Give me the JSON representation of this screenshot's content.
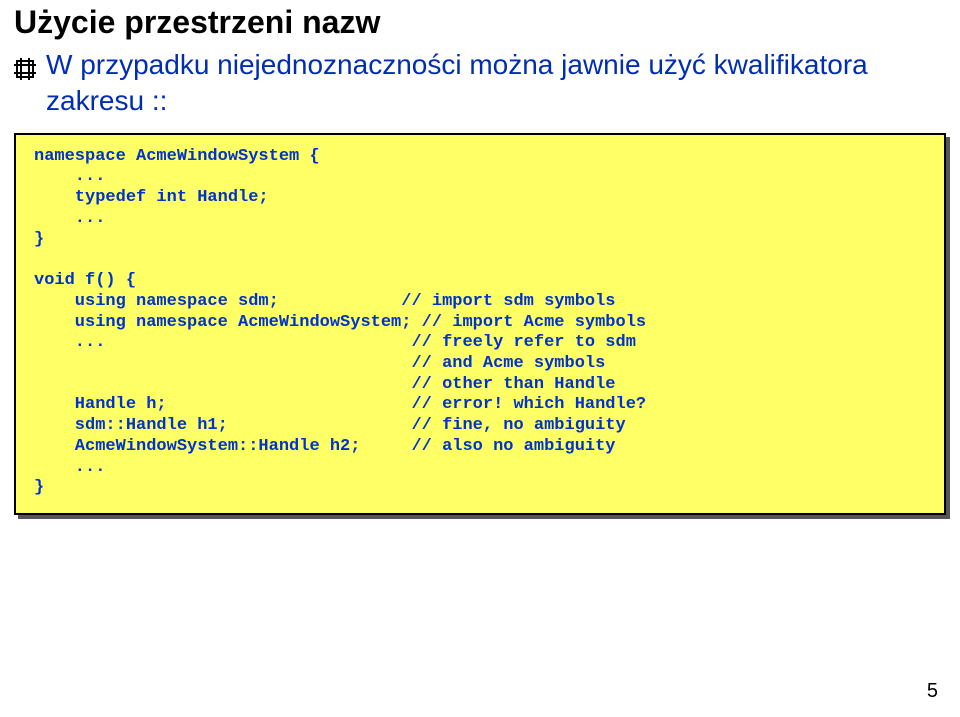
{
  "title": "Użycie przestrzeni nazw",
  "bullet": "W przypadku niejednoznaczności można jawnie użyć kwalifikatora zakresu ::",
  "code": "namespace AcmeWindowSystem {\n    ...\n    typedef int Handle;\n    ...\n}\n\nvoid f() {\n    using namespace sdm;            // import sdm symbols\n    using namespace AcmeWindowSystem; // import Acme symbols\n    ...                              // freely refer to sdm\n                                     // and Acme symbols\n                                     // other than Handle\n    Handle h;                        // error! which Handle?\n    sdm::Handle h1;                  // fine, no ambiguity\n    AcmeWindowSystem::Handle h2;     // also no ambiguity\n    ...\n}",
  "page_number": "5"
}
